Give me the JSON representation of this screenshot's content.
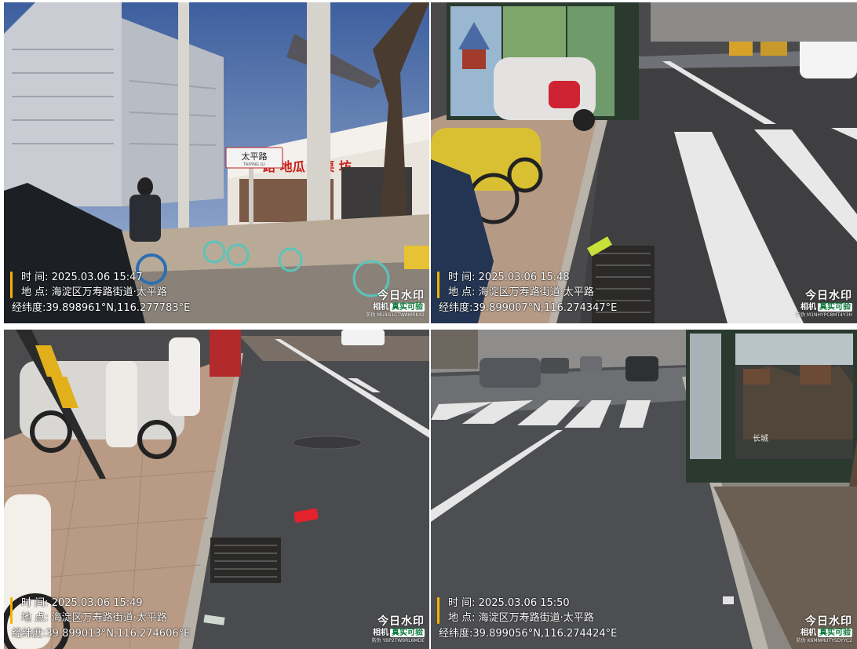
{
  "panels": [
    {
      "time_label": "时 间:",
      "time": "2025.03.06 15:47",
      "place_label": "地 点:",
      "place": "海淀区万寿路街道·太平路",
      "coord_label": "经纬度:",
      "coord": "39.898961°N,116.277783°E",
      "sign_text": "太平路",
      "sign_sub": "TAIPING LU"
    },
    {
      "time_label": "时 间:",
      "time": "2025.03.06 15:48",
      "place_label": "地 点:",
      "place": "海淀区万寿路街道·太平路",
      "coord_label": "经纬度:",
      "coord": "39.899007°N,116.274347°E"
    },
    {
      "time_label": "时 间:",
      "time": "2025.03.06 15:49",
      "place_label": "地 点:",
      "place": "海淀区万寿路街道·太平路",
      "coord_label": "经纬度:",
      "coord": "39.899013°N,116.274606°E"
    },
    {
      "time_label": "时 间:",
      "time": "2025.03.06 15:50",
      "place_label": "地 点:",
      "place": "海淀区万寿路街道·太平路",
      "coord_label": "经纬度:",
      "coord": "39.899056°N,116.274424°E",
      "poster_caption": "长城"
    }
  ],
  "watermark": {
    "brand": "今日水印",
    "camera": "相机",
    "verified": "真实可验",
    "codes": [
      "防伪 MU4G1CTWAWRK42",
      "防伪 M1NHYPC8MT4Y3H",
      "防伪 YBP2TW9RL6MDE",
      "防伪 K6MNMUTY5DYYC2"
    ]
  },
  "colors": {
    "stamp_bar": "#f3b400",
    "verified_text": "#0a7a3a"
  }
}
